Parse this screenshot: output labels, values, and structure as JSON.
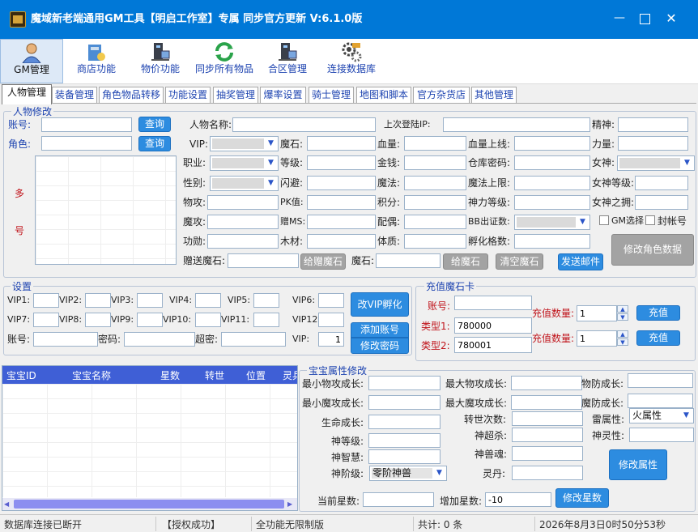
{
  "window": {
    "title": "魔域新老端通用GM工具【明启工作室】专属 同步官方更新 V:6.1.0版",
    "min": "—",
    "max": "☐",
    "close": "✕"
  },
  "toolbar": [
    {
      "label": "GM管理",
      "icon": "user-icon"
    },
    {
      "label": "商店功能",
      "icon": "shop-icon"
    },
    {
      "label": "物价功能",
      "icon": "computer-icon"
    },
    {
      "label": "同步所有物品",
      "icon": "sync-icon"
    },
    {
      "label": "合区管理",
      "icon": "computer-icon"
    },
    {
      "label": "连接数据库",
      "icon": "gear-icon"
    }
  ],
  "tabs": [
    "人物管理",
    "装备管理",
    "角色物品转移",
    "功能设置",
    "抽奖管理",
    "爆率设置",
    "骑士管理",
    "地图和脚本",
    "官方杂货店",
    "其他管理"
  ],
  "char": {
    "group": "人物修改",
    "account": "账号:",
    "role": "角色:",
    "query": "查询",
    "multi1": "多",
    "multi2": "号",
    "name": "人物名称:",
    "last_ip": "上次登陆IP:",
    "spirit": "精神:",
    "vip": "VIP:",
    "magicstone": "魔石:",
    "hp": "血量:",
    "hp_max": "血量上线:",
    "power": "力量:",
    "job": "职业:",
    "level": "等级:",
    "gold": "金钱:",
    "storage_pwd": "仓库密码:",
    "goddess": "女神:",
    "gender": "性别:",
    "dodge": "闪避:",
    "mana": "魔法:",
    "mana_max": "魔法上限:",
    "goddess_level": "女神等级:",
    "phys_atk": "物攻:",
    "pk": "PK值:",
    "points": "积分:",
    "divine_level": "神力等级:",
    "goddess_hug": "女神之拥:",
    "magic_atk": "魔攻:",
    "gift_ms": "赠MS:",
    "spouse": "配偶:",
    "bb_slots": "BB出证数:",
    "gm_select": "GM选择",
    "ban": "封帐号",
    "merit": "功勋:",
    "wood": "木材:",
    "physique": "体质:",
    "hatch": "孵化格数:",
    "gift_stone": "赠送魔石:",
    "give_gift_stone": "给赠魔石",
    "stone": "魔石:",
    "give_stone": "给魔石",
    "clear_stone": "清空魔石",
    "send_mail": "发送邮件",
    "modify": "修改角色数据"
  },
  "settings": {
    "group": "设置",
    "vips": [
      "VIP1:",
      "VIP2:",
      "VIP3:",
      "VIP4:",
      "VIP5:",
      "VIP6:",
      "VIP7:",
      "VIP8:",
      "VIP9:",
      "VIP10:",
      "VIP11:",
      "VIP12"
    ],
    "account": "账号:",
    "password": "密码:",
    "super": "超密:",
    "vip": "VIP:",
    "vip_value": "1",
    "change_vip": "改VIP孵化",
    "add_account": "添加账号",
    "change_pwd": "修改密码"
  },
  "recharge": {
    "group": "充值魔石卡",
    "account": "账号:",
    "type1": "类型1:",
    "type1_value": "780000",
    "type2": "类型2:",
    "type2_value": "780001",
    "qty": "充值数量:",
    "qty1": "1",
    "qty2": "1",
    "recharge": "充值"
  },
  "pets": {
    "columns": [
      "宝宝ID",
      "宝宝名称",
      "星数",
      "转世",
      "位置",
      "灵兵"
    ]
  },
  "pet_attr": {
    "group": "宝宝属性修改",
    "min_phys": "最小物攻成长:",
    "max_phys": "最大物攻成长:",
    "phys_def": "物防成长:",
    "min_magic": "最小魔攻成长:",
    "max_magic": "最大魔攻成长:",
    "magic_def": "魔防成长:",
    "life": "生命成长:",
    "rebirth": "转世次数:",
    "thunder": "雷属性:",
    "thunder_value": "火属性",
    "god_level": "神等级:",
    "god_kill": "神超杀:",
    "god_spirit": "神灵性:",
    "god_wisdom": "神智慧:",
    "beast_soul": "神兽魂:",
    "stage": "神阶级:",
    "stage_value": "零阶神兽",
    "pill": "灵丹:",
    "modify": "修改属性",
    "cur_star": "当前星数:",
    "add_star": "增加星数:",
    "add_star_value": "-10",
    "modify_star": "修改星数"
  },
  "status": {
    "db": "数据库连接已断开",
    "auth": "【授权成功】",
    "edition": "全功能无限制版",
    "total": "共计: 0 条",
    "time": "2026年8月3日0时50分53秒"
  }
}
